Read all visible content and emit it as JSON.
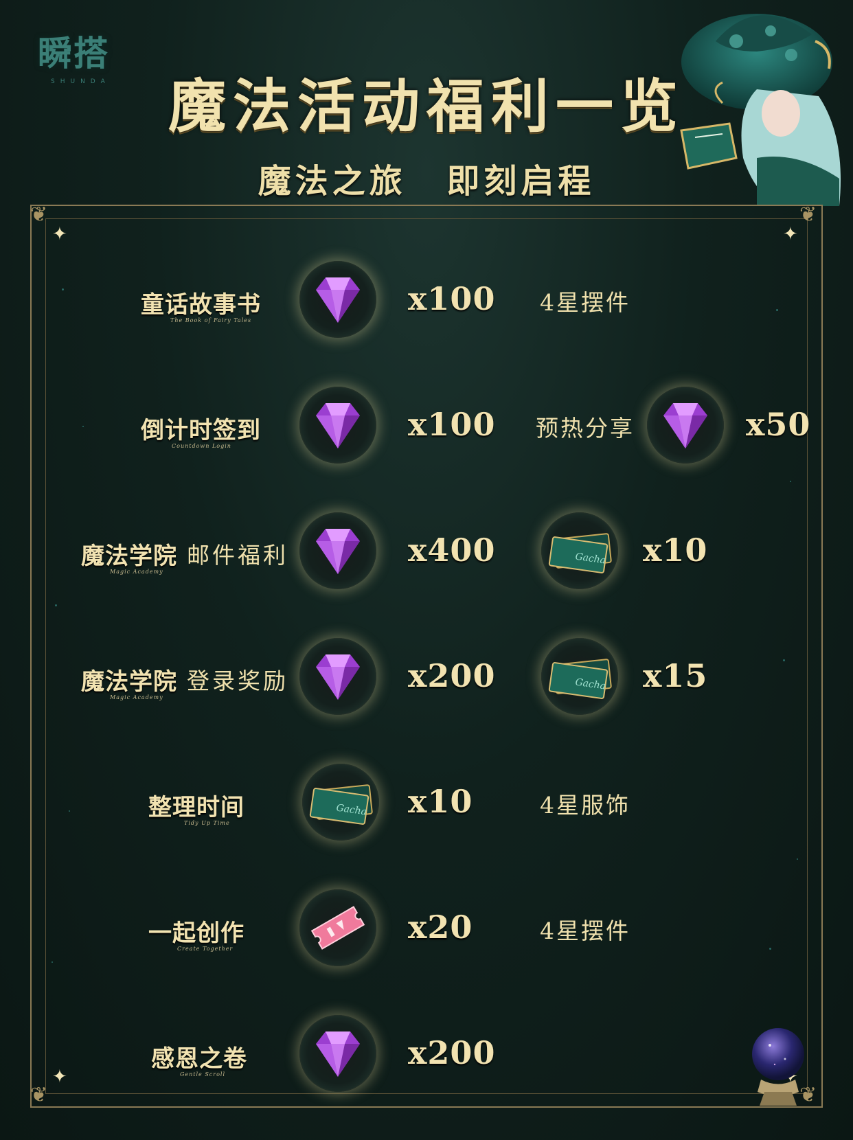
{
  "header": {
    "logo": "瞬搭",
    "logo_sub": "SHUNDA",
    "title": "魔法活动福利一览",
    "subtitle_part1": "魔法之旅",
    "subtitle_part2": "即刻启程"
  },
  "rows": [
    {
      "label": "童话故事书",
      "tagline": "The Book of Fairy Tales",
      "items": [
        {
          "icon": "purple-gem-icon",
          "quantity": "x100"
        }
      ],
      "extra_text": "4星摆件"
    },
    {
      "label": "倒计时签到",
      "tagline": "Countdown Login",
      "items": [
        {
          "icon": "purple-gem-icon",
          "quantity": "x100"
        }
      ],
      "extra_text": "预热分享",
      "extra_items": [
        {
          "icon": "purple-gem-icon",
          "quantity": "x50"
        }
      ]
    },
    {
      "label": "魔法学院",
      "label_suffix": "邮件福利",
      "tagline": "Magic Academy",
      "items": [
        {
          "icon": "purple-gem-icon",
          "quantity": "x400"
        },
        {
          "icon": "gacha-ticket-icon",
          "quantity": "x10",
          "ticket_text": "Gacha"
        }
      ]
    },
    {
      "label": "魔法学院",
      "label_suffix": "登录奖励",
      "tagline": "Magic Academy",
      "items": [
        {
          "icon": "purple-gem-icon",
          "quantity": "x200"
        },
        {
          "icon": "gacha-ticket-icon",
          "quantity": "x15",
          "ticket_text": "Gacha"
        }
      ]
    },
    {
      "label": "整理时间",
      "tagline": "Tidy Up Time",
      "items": [
        {
          "icon": "gacha-ticket-icon",
          "quantity": "x10",
          "ticket_text": "Gacha"
        }
      ],
      "extra_text": "4星服饰"
    },
    {
      "label": "一起创作",
      "tagline": "Create Together",
      "items": [
        {
          "icon": "pink-ticket-icon",
          "quantity": "x20"
        }
      ],
      "extra_text": "4星摆件"
    },
    {
      "label": "感恩之卷",
      "tagline": "Gentle Scroll",
      "items": [
        {
          "icon": "purple-gem-icon",
          "quantity": "x200"
        }
      ]
    }
  ],
  "colors": {
    "background": "#0f1f1c",
    "gold_text": "#f2e3b1",
    "frame_gold": "#8a7a55",
    "gem_purple": "#b14ae0",
    "ticket_green": "#1d6b5a",
    "ticket_pink": "#e86b8e",
    "logo_teal": "#3b7f77"
  }
}
